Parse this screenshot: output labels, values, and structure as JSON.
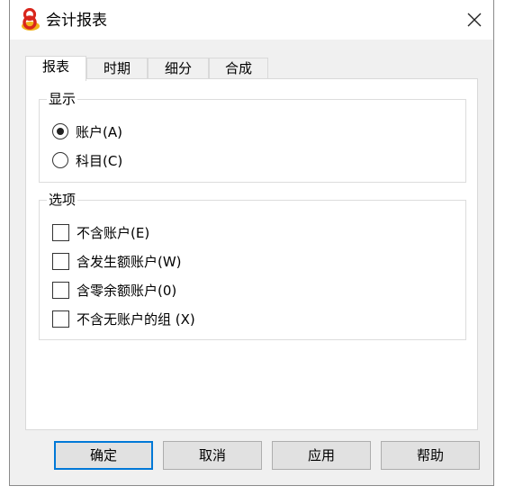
{
  "window": {
    "title": "会计报表",
    "app_icon": "app-logo-icon",
    "close_icon": "close-icon"
  },
  "tabs": [
    {
      "label": "报表",
      "active": true
    },
    {
      "label": "时期",
      "active": false
    },
    {
      "label": "细分",
      "active": false
    },
    {
      "label": "合成",
      "active": false
    }
  ],
  "display_group": {
    "title": "显示",
    "options": [
      {
        "label": "账户(A)",
        "checked": true
      },
      {
        "label": "科目(C)",
        "checked": false
      }
    ]
  },
  "options_group": {
    "title": "选项",
    "options": [
      {
        "label": "不含账户(E)",
        "checked": false
      },
      {
        "label": "含发生额账户(W)",
        "checked": false
      },
      {
        "label": "含零余额账户(0)",
        "checked": false
      },
      {
        "label": "不含无账户的组 (X)",
        "checked": false
      }
    ]
  },
  "buttons": {
    "ok": "确定",
    "cancel": "取消",
    "apply": "应用",
    "help": "帮助"
  },
  "colors": {
    "dialog_bg": "#f0f0f0",
    "panel_bg": "#ffffff",
    "default_button_border": "#0078d7",
    "logo_red": "#d9261c",
    "logo_yellow": "#f2b21b"
  }
}
